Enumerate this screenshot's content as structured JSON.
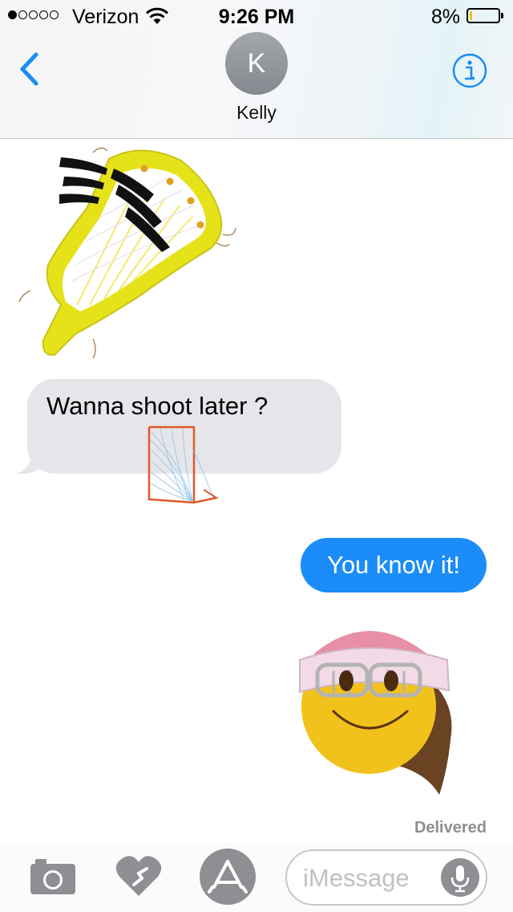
{
  "status_bar": {
    "carrier": "Verizon",
    "signal_bars_filled": 1,
    "signal_bars_total": 5,
    "time": "9:26 PM",
    "battery_percent": "8%",
    "battery_level": 0.08
  },
  "header": {
    "avatar_initial": "K",
    "contact_name": "Kelly"
  },
  "messages": [
    {
      "type": "sticker",
      "direction": "incoming",
      "description": "lacrosse-stick-head-sticker"
    },
    {
      "type": "text",
      "direction": "incoming",
      "text": "Wanna shoot later ?"
    },
    {
      "type": "sticker",
      "direction": "incoming",
      "description": "lacrosse-goal-sticker"
    },
    {
      "type": "text",
      "direction": "outgoing",
      "text": "You know it!"
    },
    {
      "type": "sticker",
      "direction": "outgoing",
      "description": "smiley-lacrosse-goggles-sticker"
    }
  ],
  "delivery_status": "Delivered",
  "input_bar": {
    "placeholder": "iMessage",
    "value": ""
  },
  "colors": {
    "accent": "#1b8cf8",
    "incoming_bubble": "#e5e5ea",
    "outgoing_bubble": "#1b8cf8",
    "gray_icons": "#8e8e93",
    "stick_yellow": "#e5e21a",
    "goal_orange": "#e0592a"
  },
  "icons": {
    "back": "chevron-left-icon",
    "info": "info-icon",
    "camera": "camera-icon",
    "digital_touch": "heart-icon",
    "app_store": "app-store-icon",
    "mic": "microphone-icon",
    "wifi": "wifi-icon",
    "battery": "battery-icon"
  }
}
